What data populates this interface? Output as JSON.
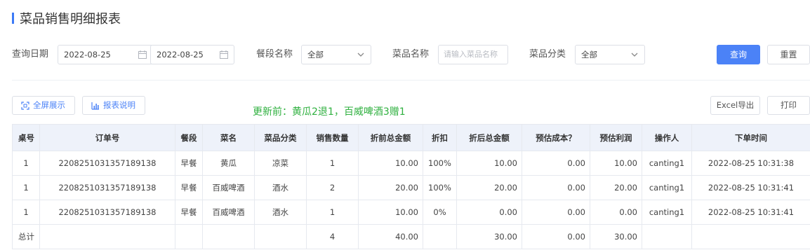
{
  "page_title": "菜品销售明细报表",
  "filters": {
    "date_label": "查询日期",
    "date_start": "2022-08-25",
    "date_end": "2022-08-25",
    "date_separator": "-",
    "meal_label": "餐段名称",
    "meal_value": "全部",
    "dish_label": "菜品名称",
    "dish_placeholder": "请输入菜品名称",
    "category_label": "菜品分类",
    "category_value": "全部",
    "search_button": "查询",
    "reset_button": "重置"
  },
  "toolbar": {
    "fullscreen_button": "全屏展示",
    "report_help_button": "报表说明",
    "note": "更新前：黄瓜2退1，百威啤酒3赠1",
    "excel_button": "Excel导出",
    "print_button": "打印"
  },
  "table": {
    "headers": [
      "桌号",
      "订单号",
      "餐段",
      "菜名",
      "菜品分类",
      "销售数量",
      "折前总金额",
      "折扣",
      "折后总金额",
      "预估成本？",
      "预估利润",
      "操作人",
      "下单时间"
    ],
    "rows": [
      [
        "1",
        "2208251031357189138",
        "早餐",
        "黄瓜",
        "凉菜",
        "1",
        "10.00",
        "100%",
        "10.00",
        "0.00",
        "10.00",
        "canting1",
        "2022-08-25 10:31:38"
      ],
      [
        "1",
        "2208251031357189138",
        "早餐",
        "百威啤酒",
        "酒水",
        "2",
        "20.00",
        "100%",
        "20.00",
        "0.00",
        "20.00",
        "canting1",
        "2022-08-25 10:31:41"
      ],
      [
        "1",
        "2208251031357189138",
        "早餐",
        "百威啤酒",
        "酒水",
        "1",
        "10.00",
        "0%",
        "0.00",
        "0.00",
        "0.00",
        "canting1",
        "2022-08-25 10:31:41"
      ]
    ],
    "total": [
      "总计",
      "",
      "",
      "",
      "",
      "4",
      "40.00",
      "",
      "30.00",
      "0.00",
      "30.00",
      "",
      ""
    ]
  },
  "colors": {
    "accent": "#4b82f7",
    "note": "#2fb03f",
    "header_bg": "#eef2fa"
  },
  "icons": [
    "calendar-icon",
    "chevron-down-icon",
    "fullscreen-icon",
    "bar-chart-icon"
  ]
}
